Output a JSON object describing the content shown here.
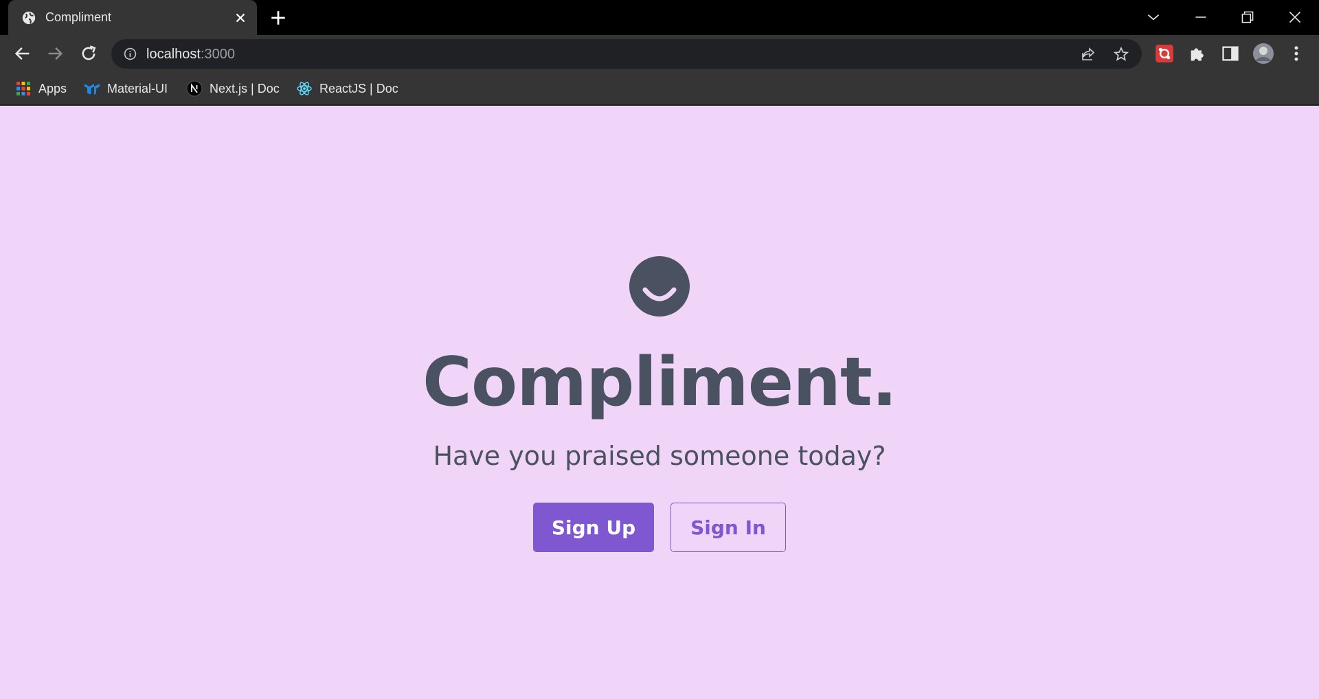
{
  "browser": {
    "tab": {
      "title": "Compliment",
      "favicon": "globe-icon"
    },
    "address": {
      "host": "localhost",
      "port": ":3000"
    },
    "bookmarks": [
      {
        "label": "Apps",
        "icon": "apps-grid-icon"
      },
      {
        "label": "Material-UI",
        "icon": "material-ui-icon"
      },
      {
        "label": "Next.js | Doc",
        "icon": "nextjs-icon"
      },
      {
        "label": "ReactJS | Doc",
        "icon": "react-icon"
      }
    ]
  },
  "page": {
    "brand": "Compliment.",
    "tagline": "Have you praised someone today?",
    "buttons": {
      "signup": "Sign Up",
      "signin": "Sign In"
    }
  },
  "colors": {
    "page_background": "#f1d5f8",
    "text": "#4a5262",
    "accent": "#7e57d1"
  }
}
